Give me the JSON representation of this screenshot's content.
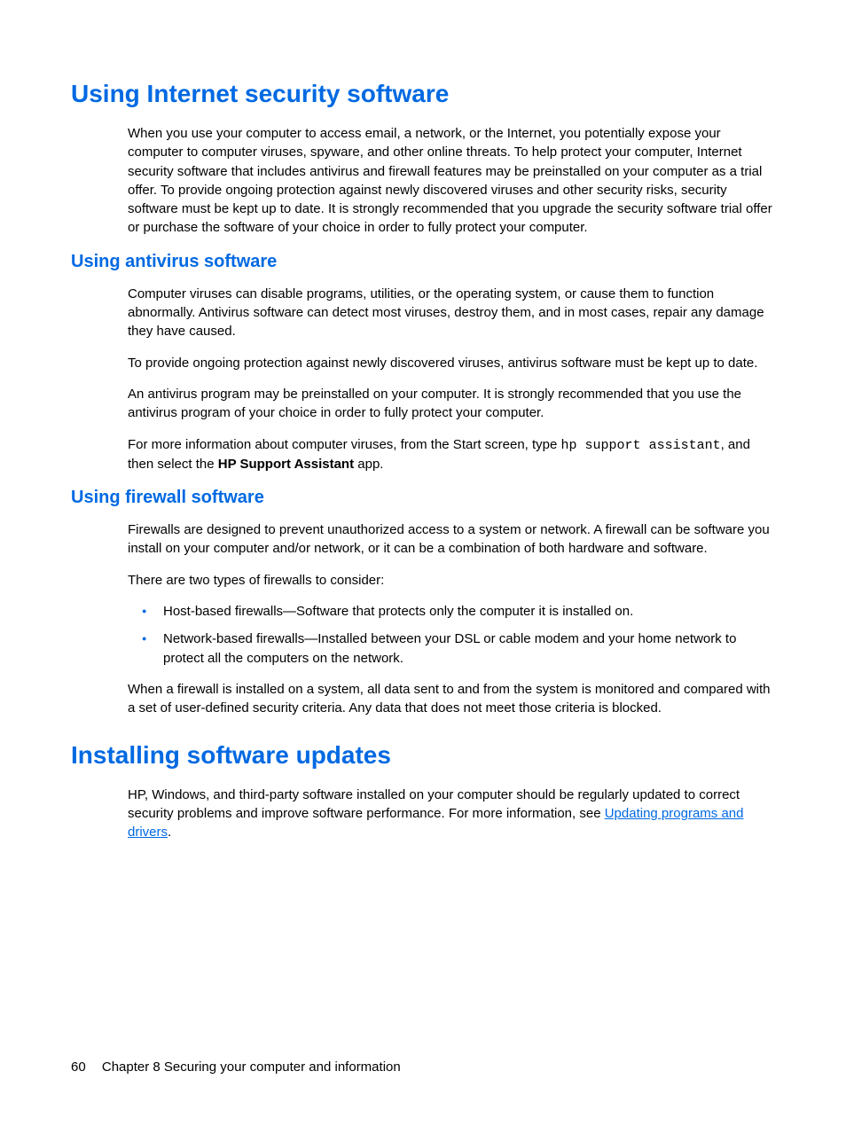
{
  "h1_security": "Using Internet security software",
  "p_security_intro": "When you use your computer to access email, a network, or the Internet, you potentially expose your computer to computer viruses, spyware, and other online threats. To help protect your computer, Internet security software that includes antivirus and firewall features may be preinstalled on your computer as a trial offer. To provide ongoing protection against newly discovered viruses and other security risks, security software must be kept up to date. It is strongly recommended that you upgrade the security software trial offer or purchase the software of your choice in order to fully protect your computer.",
  "h2_antivirus": "Using antivirus software",
  "p_av_1": "Computer viruses can disable programs, utilities, or the operating system, or cause them to function abnormally. Antivirus software can detect most viruses, destroy them, and in most cases, repair any damage they have caused.",
  "p_av_2": "To provide ongoing protection against newly discovered viruses, antivirus software must be kept up to date.",
  "p_av_3": "An antivirus program may be preinstalled on your computer. It is strongly recommended that you use the antivirus program of your choice in order to fully protect your computer.",
  "p_av_4_prefix": "For more information about computer viruses, from the Start screen, type ",
  "p_av_4_code": "hp support assistant",
  "p_av_4_mid": ", and then select the ",
  "p_av_4_bold": "HP Support Assistant",
  "p_av_4_suffix": " app.",
  "h2_firewall": "Using firewall software",
  "p_fw_1": "Firewalls are designed to prevent unauthorized access to a system or network. A firewall can be software you install on your computer and/or network, or it can be a combination of both hardware and software.",
  "p_fw_2": "There are two types of firewalls to consider:",
  "li_fw_1": "Host-based firewalls—Software that protects only the computer it is installed on.",
  "li_fw_2": "Network-based firewalls—Installed between your DSL or cable modem and your home network to protect all the computers on the network.",
  "p_fw_3": "When a firewall is installed on a system, all data sent to and from the system is monitored and compared with a set of user-defined security criteria. Any data that does not meet those criteria is blocked.",
  "h1_updates": "Installing software updates",
  "p_up_prefix": "HP, Windows, and third-party software installed on your computer should be regularly updated to correct security problems and improve software performance. For more information, see ",
  "p_up_link": "Updating programs and drivers",
  "p_up_suffix": ".",
  "footer_page": "60",
  "footer_chapter": "Chapter 8   Securing your computer and information"
}
